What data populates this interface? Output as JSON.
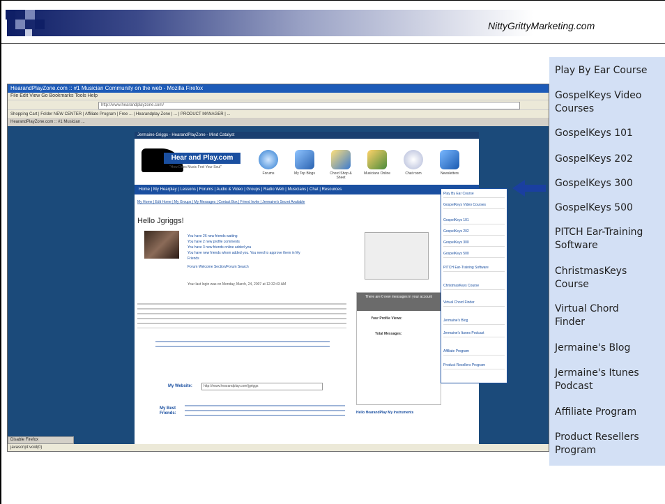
{
  "header": {
    "site": "NittyGrittyMarketing.com"
  },
  "browser": {
    "title": "HearandPlayZone.com :: #1 Musician Community on the web - Mozilla Firefox",
    "menu": "File  Edit  View  Go  Bookmarks  Tools  Help",
    "address": "http://www.hearandplayzone.com/",
    "bookmarks": "Shopping Cart | Folder NEW CENTER | Affiliate Program | Free ... | Hearandplay Zone | ... | PRODUCT MANAGER | ...",
    "tab": "HearandPlayZone.com :: #1 Musician ...",
    "status": "javascript:void(0)",
    "taskbar": "Disable Firefox"
  },
  "page": {
    "topstrip": "Jermaine Griggs - HearandPlayZone - Mind Catalyst",
    "logo": "Hear and Play.com",
    "tagline": "\"How Does Music Feel Your Soul\"",
    "icons": [
      "Forums",
      "My Top Blogs",
      "Chord Shop & Sheet",
      "Musicians Online",
      "Chat room",
      "Newsletters"
    ],
    "nav": "Home  |  My Hearplay  |  Lessons  |  Forums  |  Audio & Video  |  Groups  |  Radio Web  |  Musicians  |  Chat  |  Resources",
    "sublinks": "My Home  |  Edit Home  |  My Groups  |  My Messages  |  Contact Box  |  Friend Invite  |  Jermaine's Secret Available",
    "hello": "Hello Jgriggs!",
    "links": [
      "You have 26 new friends waiting",
      "You have 2 new profile comments",
      "You have 3 new friends online added you",
      "You have new friends whom added you. You need to approve them in My Friends",
      "Forum Welcome Section/Forum Search"
    ],
    "last_login": "Your last login was on Monday, March, 24, 2007 at 12:32:43 AM",
    "messages_head": "There are 0 new messages in your account",
    "profile_views": "Your Profile Views:",
    "total_messages": "Total Messages:",
    "musicians": "Hello HearandPlay My Instruments",
    "my_website": "My Website:",
    "website_url": "http://www.hearandplay.com/jgriggs",
    "best_friends": "My Best Friends:"
  },
  "dropdown": [
    "Play By Ear Course",
    "GospelKeys Video Courses",
    "GospelKeys 101",
    "GospelKeys 202",
    "GospelKeys 300",
    "GospelKeys 500",
    "PITCH Ear-Training Software",
    "ChristmasKeys Course",
    "Virtual Chord Finder",
    "Jermaine's Blog",
    "Jermaine's Itunes Podcast",
    "Affiliate Program",
    "Product Resellers Program"
  ],
  "menu_zoom": [
    {
      "label": "Play By Ear Course"
    },
    {
      "label": "GospelKeys Video\nCourses"
    },
    {
      "label": "GospelKeys 101"
    },
    {
      "label": "GospelKeys 202"
    },
    {
      "label": "GospelKeys 300"
    },
    {
      "label": "GospelKeys 500"
    },
    {
      "label": "PITCH Ear-Training\nSoftware"
    },
    {
      "label": "ChristmasKeys\nCourse"
    },
    {
      "label": "Virtual Chord\nFinder"
    },
    {
      "label": "Jermaine's Blog"
    },
    {
      "label": "Jermaine's Itunes\nPodcast"
    },
    {
      "label": "Affiliate Program"
    },
    {
      "label": "Product Resellers\nProgram"
    }
  ],
  "colors": {
    "arrow": "#1a3fa0",
    "menu_bg": "#d3e0f5",
    "browser_bg": "#1b4a7a",
    "header_dark": "#0f1f66"
  }
}
